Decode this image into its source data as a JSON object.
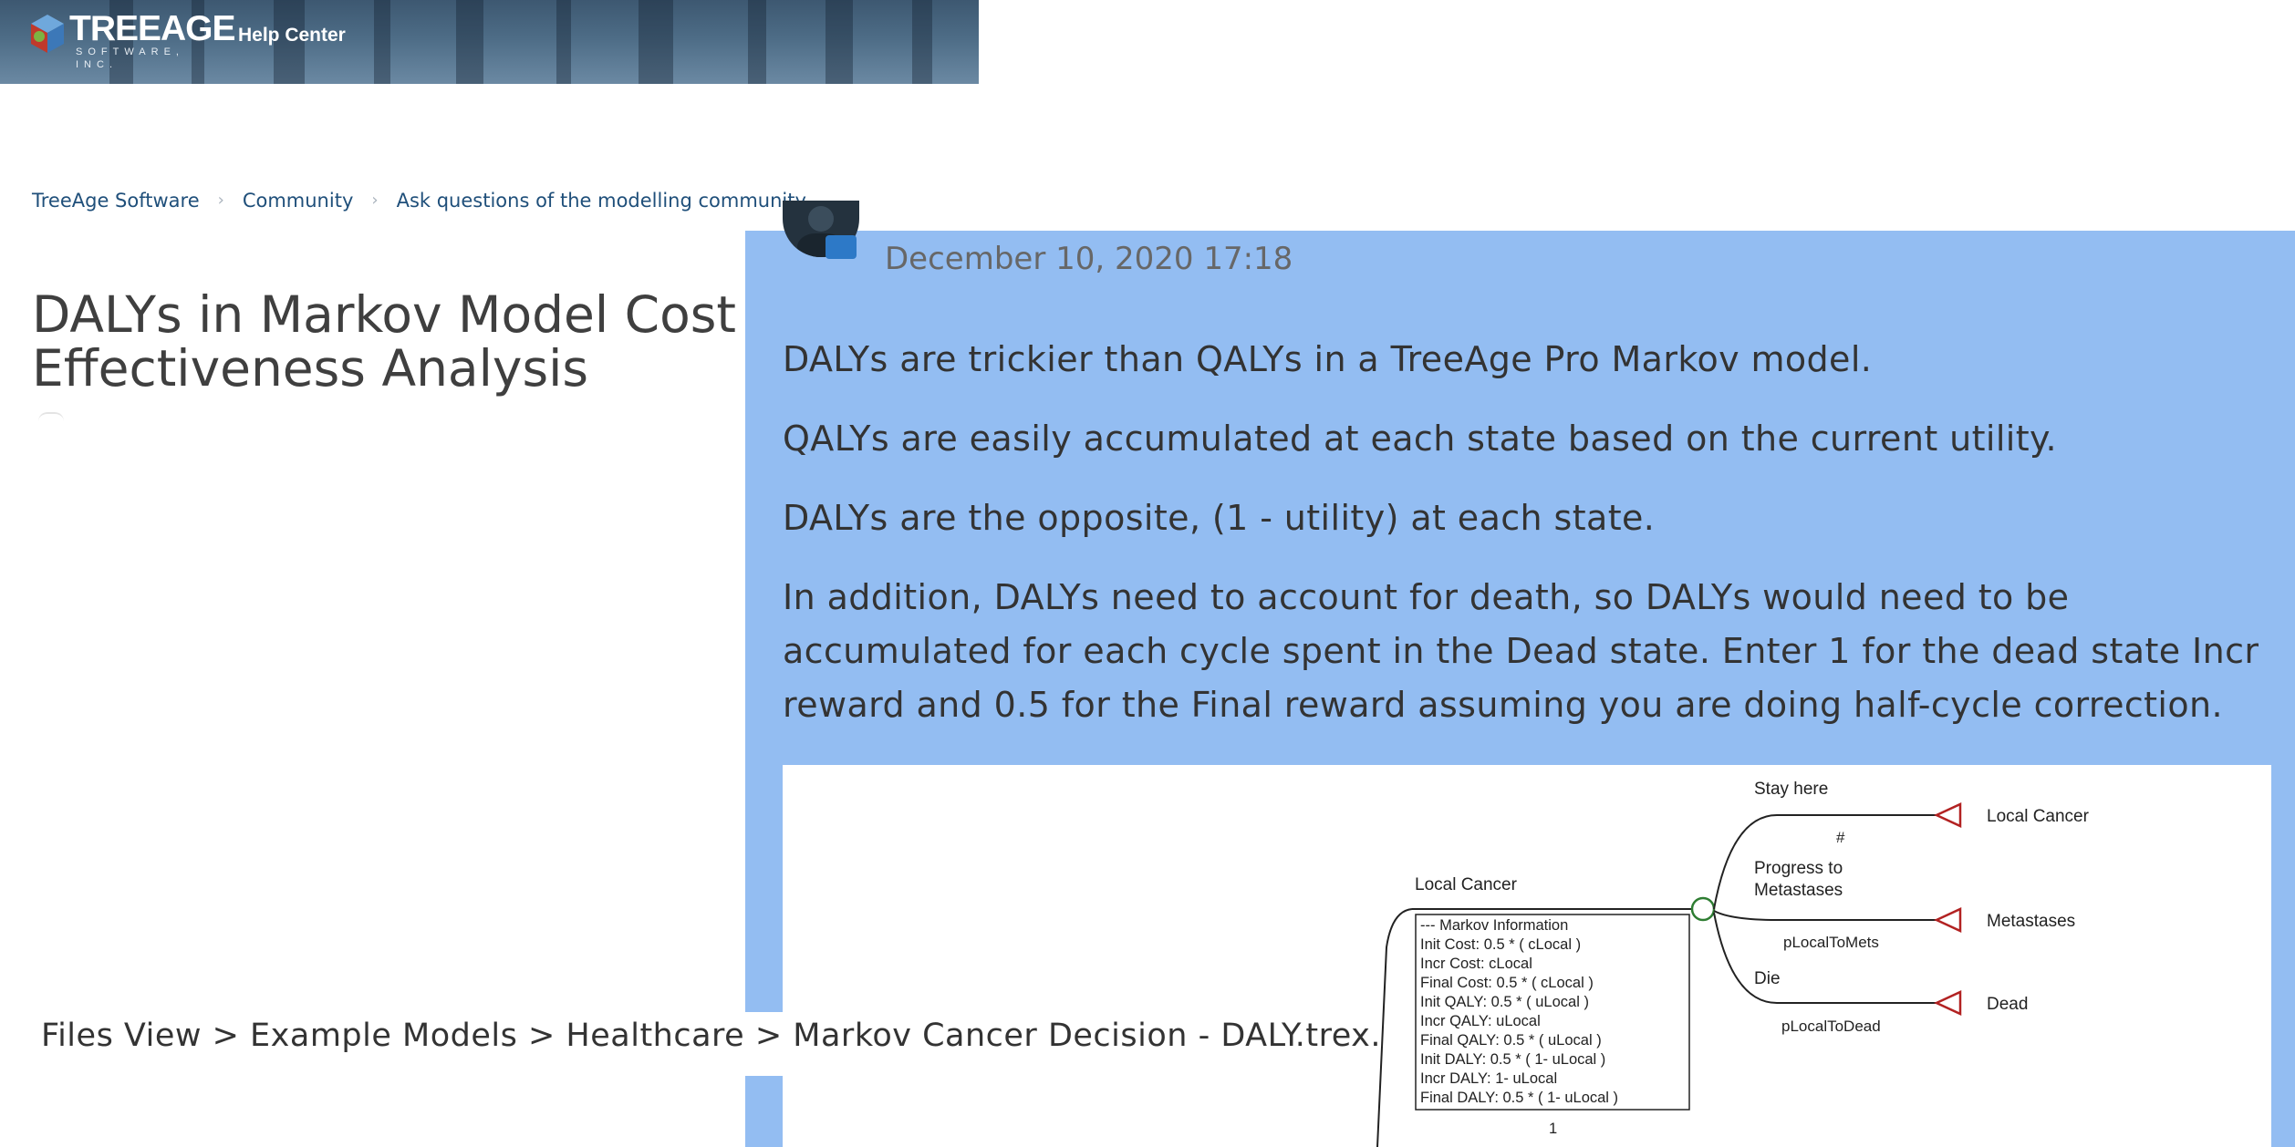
{
  "header": {
    "logo_text": "TREEAGE",
    "logo_subtext": "SOFTWARE, INC.",
    "help_center_label": "Help Center"
  },
  "breadcrumb": {
    "items": [
      "TreeAge Software",
      "Community",
      "Ask questions of the modelling community"
    ],
    "separator": "›"
  },
  "article": {
    "title": "DALYs in Markov Model Cost Effectiveness Analysis"
  },
  "post": {
    "date": "December 10, 2020 17:18",
    "paragraphs": [
      "DALYs are trickier than QALYs in a TreeAge Pro Markov model.",
      "QALYs are easily accumulated at each state based on the current utility.",
      "DALYs are the opposite, (1 - utility) at each state.",
      "In addition, DALYs need to account for death, so DALYs would need to be accumulated for each cycle spent in the Dead state. Enter 1 for the dead state Incr reward and 0.5 for the Final reward assuming you are doing half-cycle correction."
    ],
    "files_path": "Files View > Example Models > Healthcare > Markov Cancer Decision - DALY.trex."
  },
  "diagram": {
    "node_label": "Local Cancer",
    "markov_info": [
      "--- Markov Information",
      "Init Cost: 0.5 * ( cLocal )",
      "Incr Cost: cLocal",
      "Final Cost: 0.5 * ( cLocal )",
      "Init QALY: 0.5 * ( uLocal )",
      "Incr QALY: uLocal",
      "Final QALY: 0.5 * ( uLocal )",
      "Init DALY: 0.5 * ( 1- uLocal )",
      "Incr DALY: 1- uLocal",
      "Final DALY: 0.5 * ( 1- uLocal )"
    ],
    "bottom_prob": "1",
    "branches": [
      {
        "label": "Stay here",
        "prob": "#",
        "target": "Local Cancer"
      },
      {
        "label": "Progress to Metastases",
        "prob": "pLocalToMets",
        "target": "Metastases"
      },
      {
        "label": "Die",
        "prob": "pLocalToDead",
        "target": "Dead"
      }
    ],
    "colors": {
      "chance_node": "#2e7d32",
      "terminal_node": "#b22222",
      "line": "#222222"
    }
  },
  "theme": {
    "panel_color": "#93bdf2",
    "link_color": "#1f4f7a"
  }
}
